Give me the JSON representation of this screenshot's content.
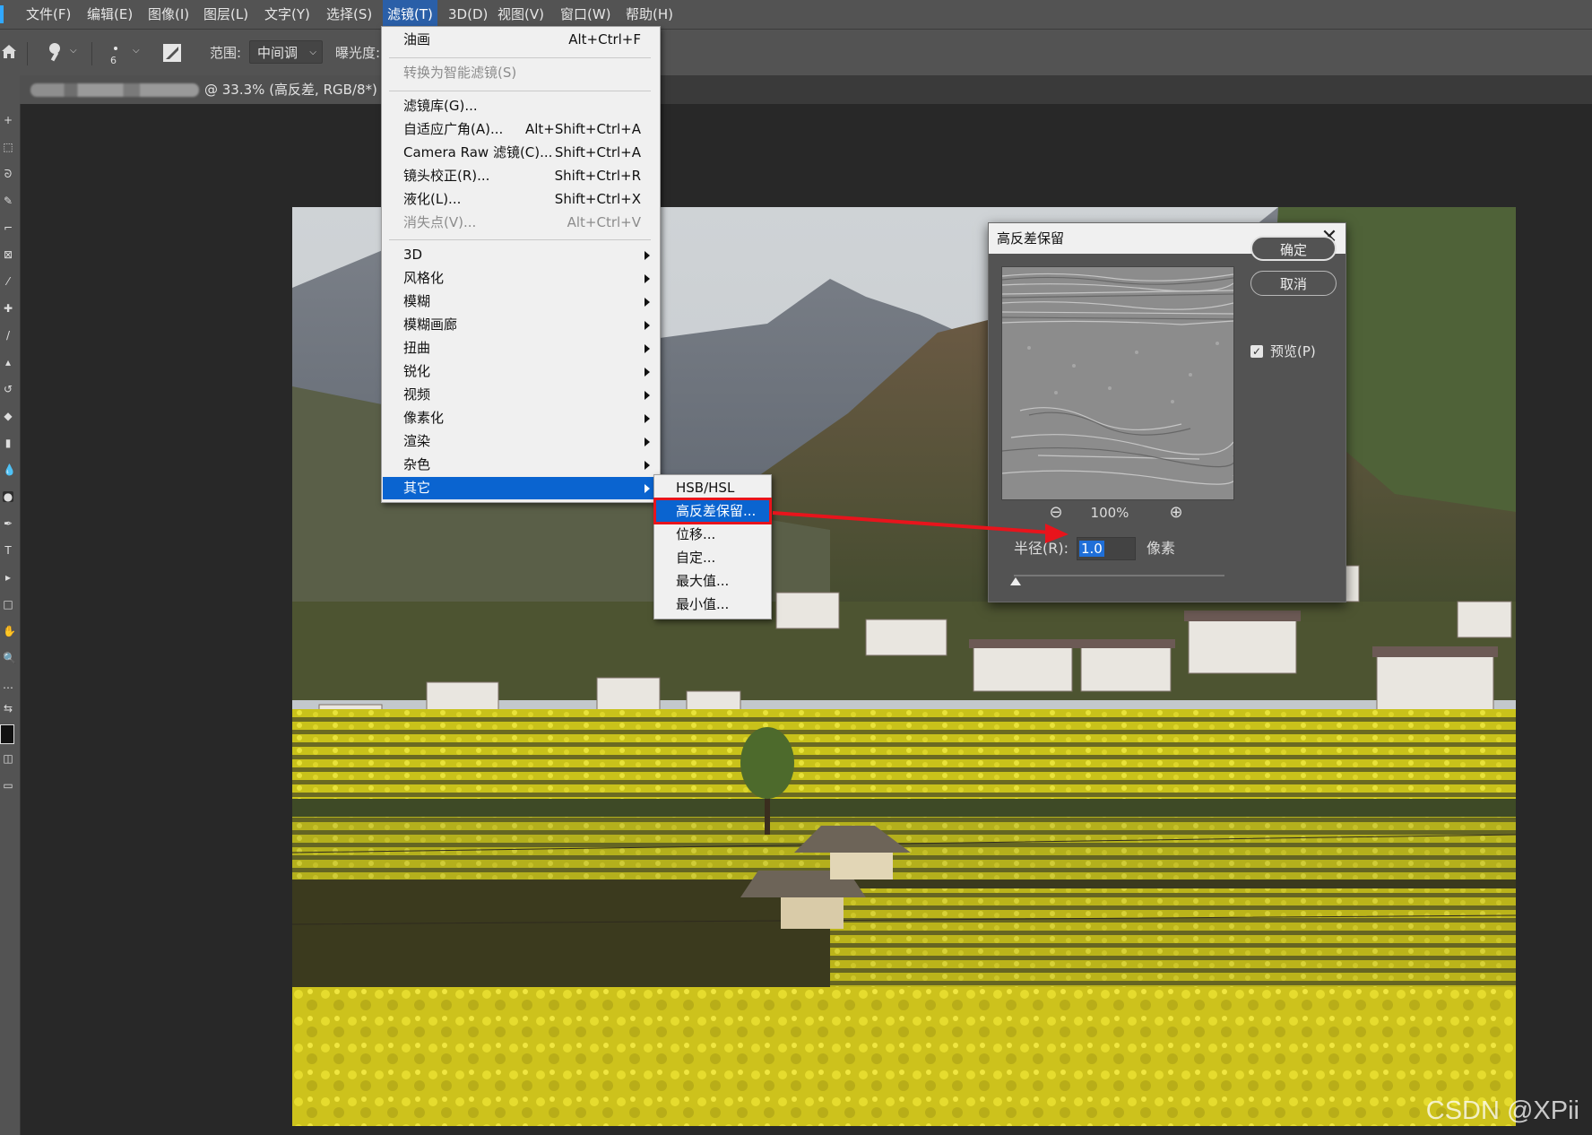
{
  "menubar": {
    "items": [
      "文件(F)",
      "编辑(E)",
      "图像(I)",
      "图层(L)",
      "文字(Y)",
      "选择(S)",
      "滤镜(T)",
      "3D(D)",
      "视图(V)",
      "窗口(W)",
      "帮助(H)"
    ]
  },
  "options": {
    "brush_size": "6",
    "range_label": "范围:",
    "range_value": "中间调",
    "exposure_label": "曝光度:"
  },
  "doc_tab": {
    "title": "@ 33.3% (高反差, RGB/8*) *"
  },
  "filter_menu": {
    "items": [
      {
        "label": "油画",
        "shortcut": "Alt+Ctrl+F"
      },
      {
        "label": "转换为智能滤镜(S)"
      },
      {
        "label": "滤镜库(G)..."
      },
      {
        "label": "自适应广角(A)...",
        "shortcut": "Alt+Shift+Ctrl+A"
      },
      {
        "label": "Camera Raw 滤镜(C)...",
        "shortcut": "Shift+Ctrl+A"
      },
      {
        "label": "镜头校正(R)...",
        "shortcut": "Shift+Ctrl+R"
      },
      {
        "label": "液化(L)...",
        "shortcut": "Shift+Ctrl+X"
      },
      {
        "label": "消失点(V)...",
        "shortcut": "Alt+Ctrl+V"
      },
      {
        "label": "3D"
      },
      {
        "label": "风格化"
      },
      {
        "label": "模糊"
      },
      {
        "label": "模糊画廊"
      },
      {
        "label": "扭曲"
      },
      {
        "label": "锐化"
      },
      {
        "label": "视频"
      },
      {
        "label": "像素化"
      },
      {
        "label": "渲染"
      },
      {
        "label": "杂色"
      },
      {
        "label": "其它"
      }
    ]
  },
  "other_submenu": {
    "items": [
      "HSB/HSL",
      "高反差保留...",
      "位移...",
      "自定...",
      "最大值...",
      "最小值..."
    ]
  },
  "dialog": {
    "title": "高反差保留",
    "ok": "确定",
    "cancel": "取消",
    "preview_label": "预览(P)",
    "preview_checked": true,
    "zoom": "100%",
    "radius_label": "半径(R):",
    "radius_value": "1.0",
    "unit": "像素"
  },
  "watermark": "CSDN @XPii",
  "colors": {
    "menu_highlight": "#0a64d0",
    "annotation": "#e8141c",
    "app_bg": "#282828"
  }
}
